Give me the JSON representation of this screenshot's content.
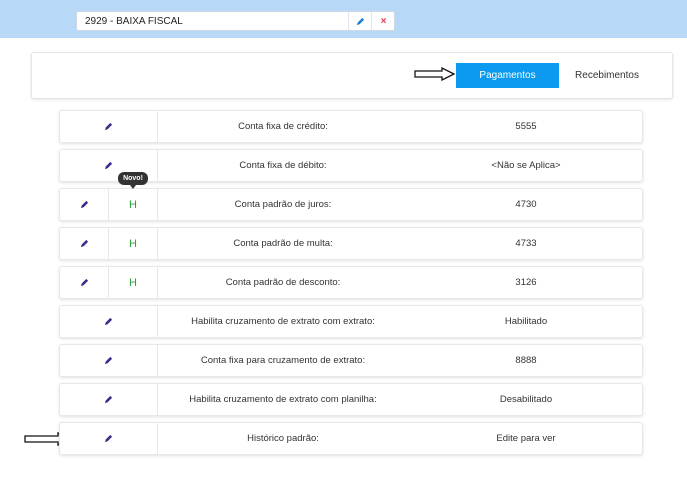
{
  "header": {
    "selector_value": "2929 - BAIXA FISCAL",
    "close_symbol": "×"
  },
  "tabs": {
    "active": "Pagamentos",
    "inactive": "Recebimentos"
  },
  "badge": "Novo!",
  "rows": [
    {
      "label": "Conta fixa de crédito:",
      "value": "5555",
      "h": ""
    },
    {
      "label": "Conta fixa de débito:",
      "value": "<Não se Aplica>",
      "h": ""
    },
    {
      "label": "Conta padrão de juros:",
      "value": "4730",
      "h": "H"
    },
    {
      "label": "Conta padrão de multa:",
      "value": "4733",
      "h": "H"
    },
    {
      "label": "Conta padrão de desconto:",
      "value": "3126",
      "h": "H"
    },
    {
      "label": "Habilita cruzamento de extrato com extrato:",
      "value": "Habilitado",
      "h": ""
    },
    {
      "label": "Conta fixa para cruzamento de extrato:",
      "value": "8888",
      "h": ""
    },
    {
      "label": "Habilita cruzamento de extrato com planilha:",
      "value": "Desabilitado",
      "h": ""
    },
    {
      "label": "Histórico padrão:",
      "value": "Edite para ver",
      "h": ""
    }
  ],
  "colors": {
    "topbar": "#b7d8f6",
    "accent": "#0b9af0",
    "h_green": "#2d9e3a",
    "close_red": "#e0384a"
  }
}
